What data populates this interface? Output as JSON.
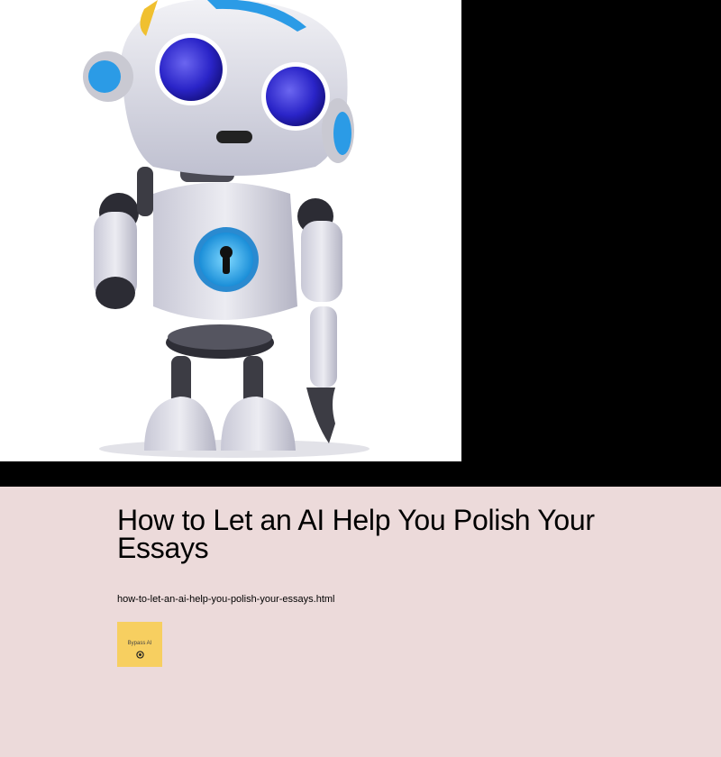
{
  "page": {
    "background": "#ecdada",
    "hero_background": "#000000"
  },
  "hero": {
    "image_icon": "robot-illustration"
  },
  "article": {
    "title": "How to Let an AI Help You Polish Your Essays",
    "filename": "how-to-let-an-ai-help-you-polish-your-essays.html"
  },
  "badge": {
    "label": "Bypass AI",
    "icon": "target-icon",
    "color": "#f7cf60"
  }
}
